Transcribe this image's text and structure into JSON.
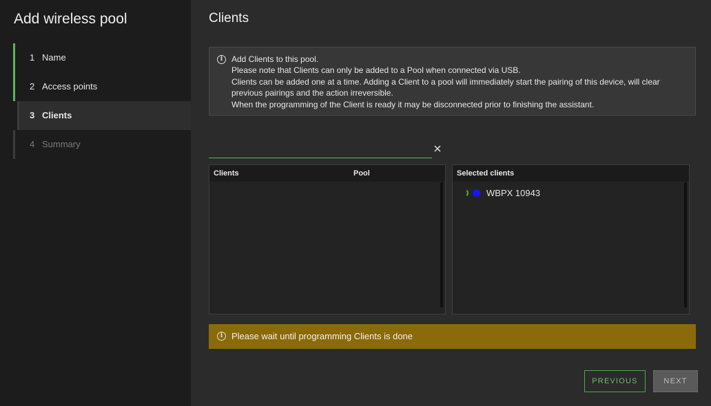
{
  "sidebar": {
    "title": "Add wireless pool",
    "steps": [
      {
        "num": "1",
        "label": "Name"
      },
      {
        "num": "2",
        "label": "Access points"
      },
      {
        "num": "3",
        "label": "Clients"
      },
      {
        "num": "4",
        "label": "Summary"
      }
    ]
  },
  "main": {
    "title": "Clients",
    "info": {
      "lines": [
        "Add Clients to this pool.",
        "Please note that Clients can only be added to a Pool when connected via USB.",
        "Clients can be added one at a time. Adding a Client to a pool will immediately start the pairing of this device, will clear",
        "previous pairings and the action irreversible.",
        "When the programming of the Client is ready it may be disconnected prior to finishing the assistant."
      ]
    },
    "search": {
      "value": "",
      "placeholder": ""
    },
    "available": {
      "col_clients": "Clients",
      "col_pool": "Pool"
    },
    "selected": {
      "header": "Selected clients",
      "items": [
        {
          "name": "WBPX 10943",
          "dot_color": "#1414ff"
        }
      ]
    },
    "warning": "Please wait until programming Clients is done",
    "buttons": {
      "previous": "PREVIOUS",
      "next": "NEXT"
    }
  },
  "colors": {
    "accent": "#5bb55a",
    "warning_bg": "#8a6a0a"
  }
}
